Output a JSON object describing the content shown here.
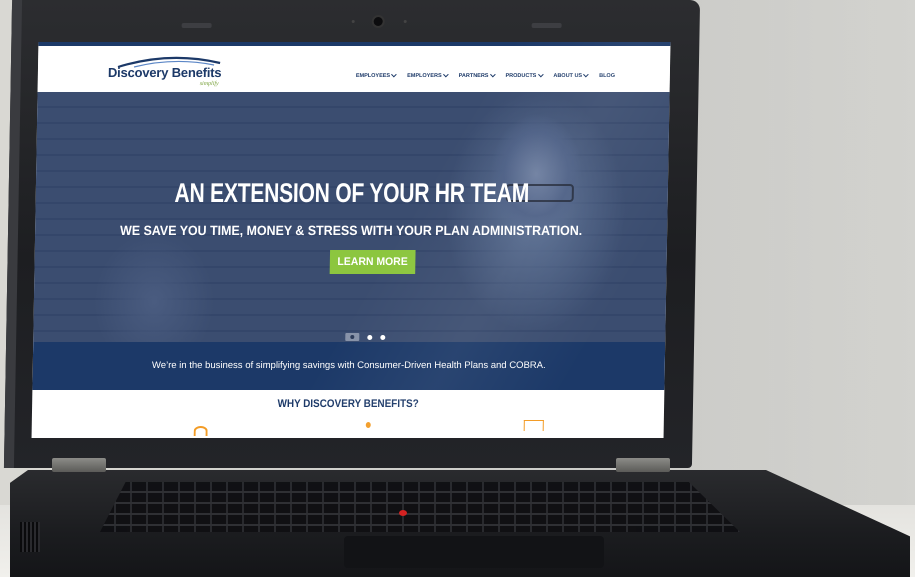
{
  "logo": {
    "name": "Discovery Benefits",
    "tagline": "simplify"
  },
  "nav": {
    "items": [
      {
        "label": "EMPLOYEES",
        "has_dropdown": true
      },
      {
        "label": "EMPLOYERS",
        "has_dropdown": true
      },
      {
        "label": "PARTNERS",
        "has_dropdown": true
      },
      {
        "label": "PRODUCTS",
        "has_dropdown": true
      },
      {
        "label": "ABOUT US",
        "has_dropdown": true
      },
      {
        "label": "BLOG",
        "has_dropdown": false
      }
    ]
  },
  "hero": {
    "title": "AN EXTENSION OF YOUR HR TEAM",
    "subtitle": "WE SAVE YOU TIME, MONEY & STRESS WITH YOUR PLAN ADMINISTRATION.",
    "cta_label": "LEARN MORE",
    "slide_count": 3,
    "active_slide": 1
  },
  "tagline": "We’re in the business of simplifying savings with Consumer-Driven Health Plans and COBRA.",
  "why_heading": "WHY DISCOVERY BENEFITS?",
  "colors": {
    "brand_navy": "#1c3968",
    "cta_green": "#8cc63f",
    "accent_orange": "#f39c26"
  }
}
